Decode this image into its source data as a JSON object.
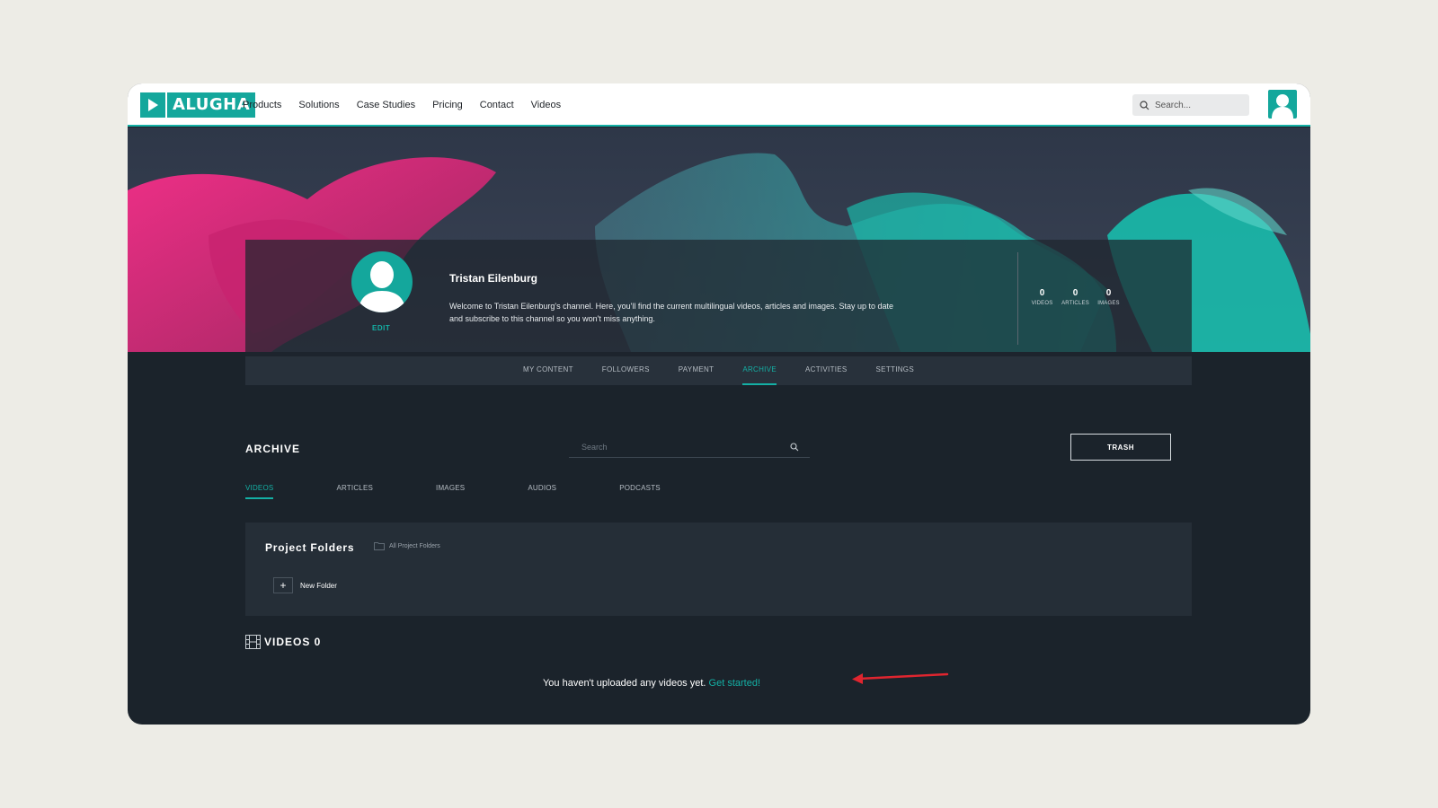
{
  "nav": {
    "logo_text": "ALUGHA",
    "links": [
      "Products",
      "Solutions",
      "Case Studies",
      "Pricing",
      "Contact",
      "Videos"
    ],
    "search_placeholder": "Search...",
    "accent_color": "#14a79c"
  },
  "profile": {
    "name": "Tristan Eilenburg",
    "edit_label": "EDIT",
    "description": "Welcome to Tristan Eilenburg's channel. Here, you'll find the current multilingual videos, articles and images. Stay up to date and subscribe to this channel so you won't miss anything.",
    "stats": [
      {
        "value": "0",
        "label": "VIDEOS"
      },
      {
        "value": "0",
        "label": "ARTICLES"
      },
      {
        "value": "0",
        "label": "IMAGES"
      }
    ]
  },
  "profile_tabs": [
    {
      "label": "MY CONTENT",
      "active": false
    },
    {
      "label": "FOLLOWERS",
      "active": false
    },
    {
      "label": "PAYMENT",
      "active": false
    },
    {
      "label": "ARCHIVE",
      "active": true
    },
    {
      "label": "ACTIVITIES",
      "active": false
    },
    {
      "label": "SETTINGS",
      "active": false
    }
  ],
  "archive": {
    "title": "ARCHIVE",
    "search_placeholder": "Search",
    "trash_label": "TRASH",
    "media_tabs": [
      {
        "label": "VIDEOS",
        "active": true
      },
      {
        "label": "ARTICLES",
        "active": false
      },
      {
        "label": "IMAGES",
        "active": false
      },
      {
        "label": "AUDIOS",
        "active": false
      },
      {
        "label": "PODCASTS",
        "active": false
      }
    ],
    "folders_title": "Project Folders",
    "all_folders_label": "All Project Folders",
    "new_folder_label": "New Folder",
    "videos_heading": "VIDEOS 0",
    "empty_message": "You haven't uploaded any videos yet.",
    "get_started_label": "Get started!"
  }
}
